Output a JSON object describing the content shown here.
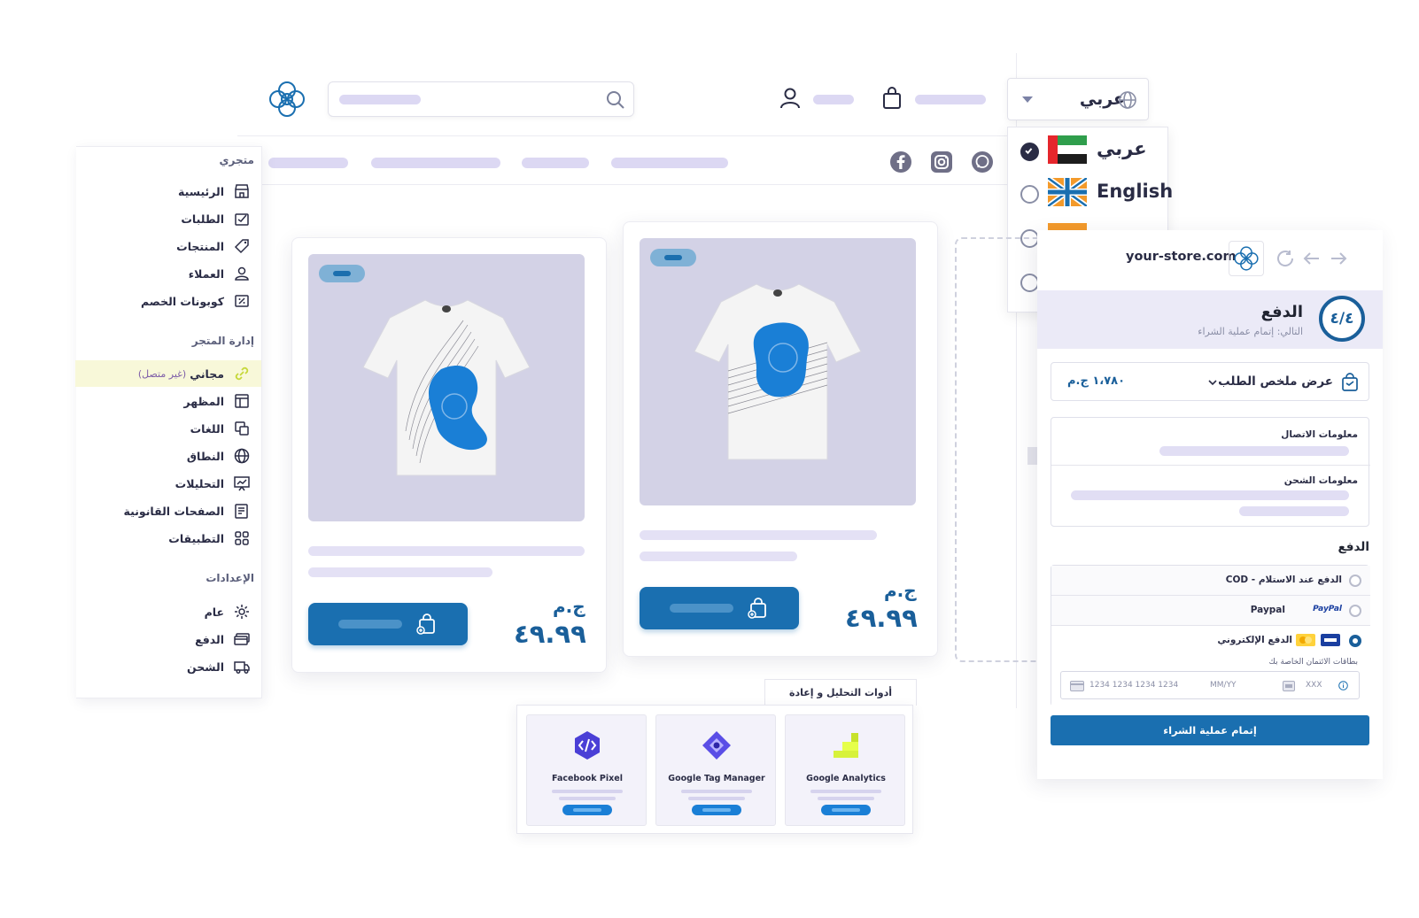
{
  "language_selector": {
    "current": "عربي",
    "options": [
      {
        "label": "عربي",
        "selected": true
      },
      {
        "label": "English",
        "selected": false
      },
      {
        "label": "",
        "selected": false
      },
      {
        "label": "",
        "selected": false
      }
    ]
  },
  "products": [
    {
      "currency": "ج.م",
      "price": "٤٩.٩٩"
    },
    {
      "currency": "ج.م",
      "price": "٤٩.٩٩"
    }
  ],
  "sidebar": {
    "section_store": "متجري",
    "store_items": [
      "الرئيسية",
      "الطلبات",
      "المنتجات",
      "العملاء",
      "كوبونات الخصم"
    ],
    "section_manage": "إدارة المتجر",
    "plan_label": "مجاني",
    "plan_status": "(غير متصل)",
    "manage_items": [
      "المظهر",
      "اللغات",
      "النطاق",
      "التحليلات",
      "الصفحات القانونية",
      "التطبيقات"
    ],
    "section_settings": "الإعدادات",
    "settings_items": [
      "عام",
      "الدفع",
      "الشحن"
    ]
  },
  "checkout": {
    "url": "your-store.com",
    "step_counter": "٤/٤",
    "step_title": "الدفع",
    "step_subtitle": "التالي: إتمام عملية الشراء",
    "summary_label": "عرض ملخص الطلب",
    "summary_total": "١،٧٨٠ ج.م",
    "contact_label": "معلومات الاتصال",
    "shipping_label": "معلومات الشحن",
    "payment_title": "الدفع",
    "pay_cod": "COD - الدفع عند الاستلام",
    "pay_paypal": "Paypal",
    "paypal_brand": "PayPal",
    "pay_card": "الدفع الإلكتروني",
    "card_sub": "بطاقات الائتمان الخاصة بك",
    "card_number_placeholder": "1234 1234 1234 1234",
    "card_expiry_placeholder": "MM/YY",
    "card_cvc_placeholder": "XXX",
    "submit_label": "إتمام عملية الشراء"
  },
  "tools": {
    "tab_label": "أدوات التحليل و إعادة الاستهداف",
    "items": [
      "Facebook Pixel",
      "Google Tag Manager",
      "Google Analytics"
    ]
  },
  "colors": {
    "primary": "#1a6fb0",
    "placeholder": "#dcd8f3",
    "brand_blue": "#1a5f9a"
  }
}
